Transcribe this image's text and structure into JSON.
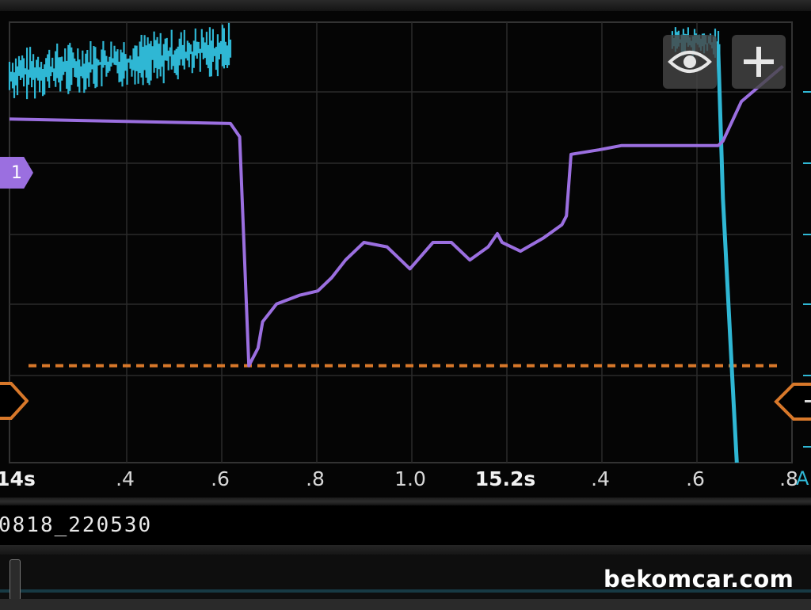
{
  "app": {
    "file_name": "0818_220530",
    "watermark": "bekomcar.com"
  },
  "controls": {
    "visibility_icon": "eye-icon",
    "add_icon": "plus-icon"
  },
  "channel_marker": {
    "label": "1",
    "color": "#9b6fe0"
  },
  "trigger": {
    "color": "#d8782a"
  },
  "x_axis": {
    "unit": "A",
    "ticks": [
      {
        "label": "14s",
        "major": true
      },
      {
        "label": ".4",
        "major": false
      },
      {
        "label": ".6",
        "major": false
      },
      {
        "label": ".8",
        "major": false
      },
      {
        "label": "1.0",
        "major": false
      },
      {
        "label": "15.2s",
        "major": true
      },
      {
        "label": ".4",
        "major": false
      },
      {
        "label": ".6",
        "major": false
      },
      {
        "label": ".8",
        "major": false
      }
    ]
  },
  "colors": {
    "channel_a": "#2fb7d4",
    "channel_b": "#9b6fe0",
    "grid": "#2b2b2b",
    "background": "#050505"
  },
  "chart_data": {
    "type": "line",
    "x_unit": "s",
    "xlim": [
      14.15,
      15.85
    ],
    "ylim": [
      0,
      1
    ],
    "grid": true,
    "trigger_level": 0.22,
    "series": [
      {
        "name": "",
        "color": "#9b6fe0",
        "x": [
          14.15,
          14.63,
          14.65,
          14.67,
          14.67,
          14.69,
          14.7,
          14.73,
          14.78,
          14.82,
          14.85,
          14.88,
          14.92,
          14.97,
          15.02,
          15.07,
          15.11,
          15.15,
          15.19,
          15.21,
          15.22,
          15.26,
          15.31,
          15.35,
          15.36,
          15.37,
          15.43,
          15.48,
          15.55,
          15.62,
          15.66,
          15.69,
          15.7,
          15.74,
          15.83
        ],
        "y": [
          0.78,
          0.77,
          0.74,
          0.22,
          0.22,
          0.26,
          0.32,
          0.36,
          0.38,
          0.39,
          0.42,
          0.46,
          0.5,
          0.49,
          0.44,
          0.5,
          0.5,
          0.46,
          0.49,
          0.52,
          0.5,
          0.48,
          0.51,
          0.54,
          0.56,
          0.7,
          0.71,
          0.72,
          0.72,
          0.72,
          0.72,
          0.72,
          0.73,
          0.82,
          0.9
        ]
      },
      {
        "name": "",
        "color": "#2fb7d4",
        "x": [
          14.15,
          14.24,
          14.34,
          14.4,
          14.49,
          14.63,
          15.59,
          15.65,
          15.69,
          15.69,
          15.7,
          15.71,
          15.72,
          15.73
        ],
        "y": [
          0.88,
          0.9,
          0.92,
          0.93,
          0.92,
          0.94,
          0.96,
          0.95,
          0.95,
          0.93,
          0.6,
          0.4,
          0.2,
          0.0
        ]
      }
    ]
  }
}
